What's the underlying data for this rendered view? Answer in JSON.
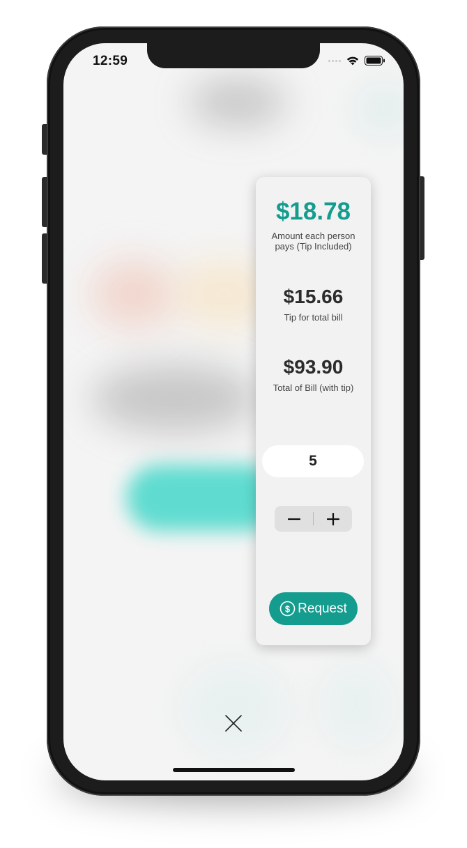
{
  "status_bar": {
    "time": "12:59",
    "icons": [
      "cellular-signal-icon",
      "wifi-icon",
      "battery-icon"
    ]
  },
  "summary": {
    "per_person_amount": "$18.78",
    "per_person_label": "Amount each person pays (Tip Included)",
    "tip_amount": "$15.66",
    "tip_label": "Tip for total bill",
    "total_amount": "$93.90",
    "total_label": "Total of Bill (with tip)"
  },
  "split": {
    "people_count": "5",
    "decrement_symbol": "−",
    "increment_symbol": "+"
  },
  "actions": {
    "request_label": "Request",
    "request_icon": "dollar-circle-icon",
    "close_icon": "close-icon"
  },
  "colors": {
    "accent": "#149c8e",
    "card_bg": "#f2f2f2",
    "text_dark": "#2b2b2b"
  }
}
